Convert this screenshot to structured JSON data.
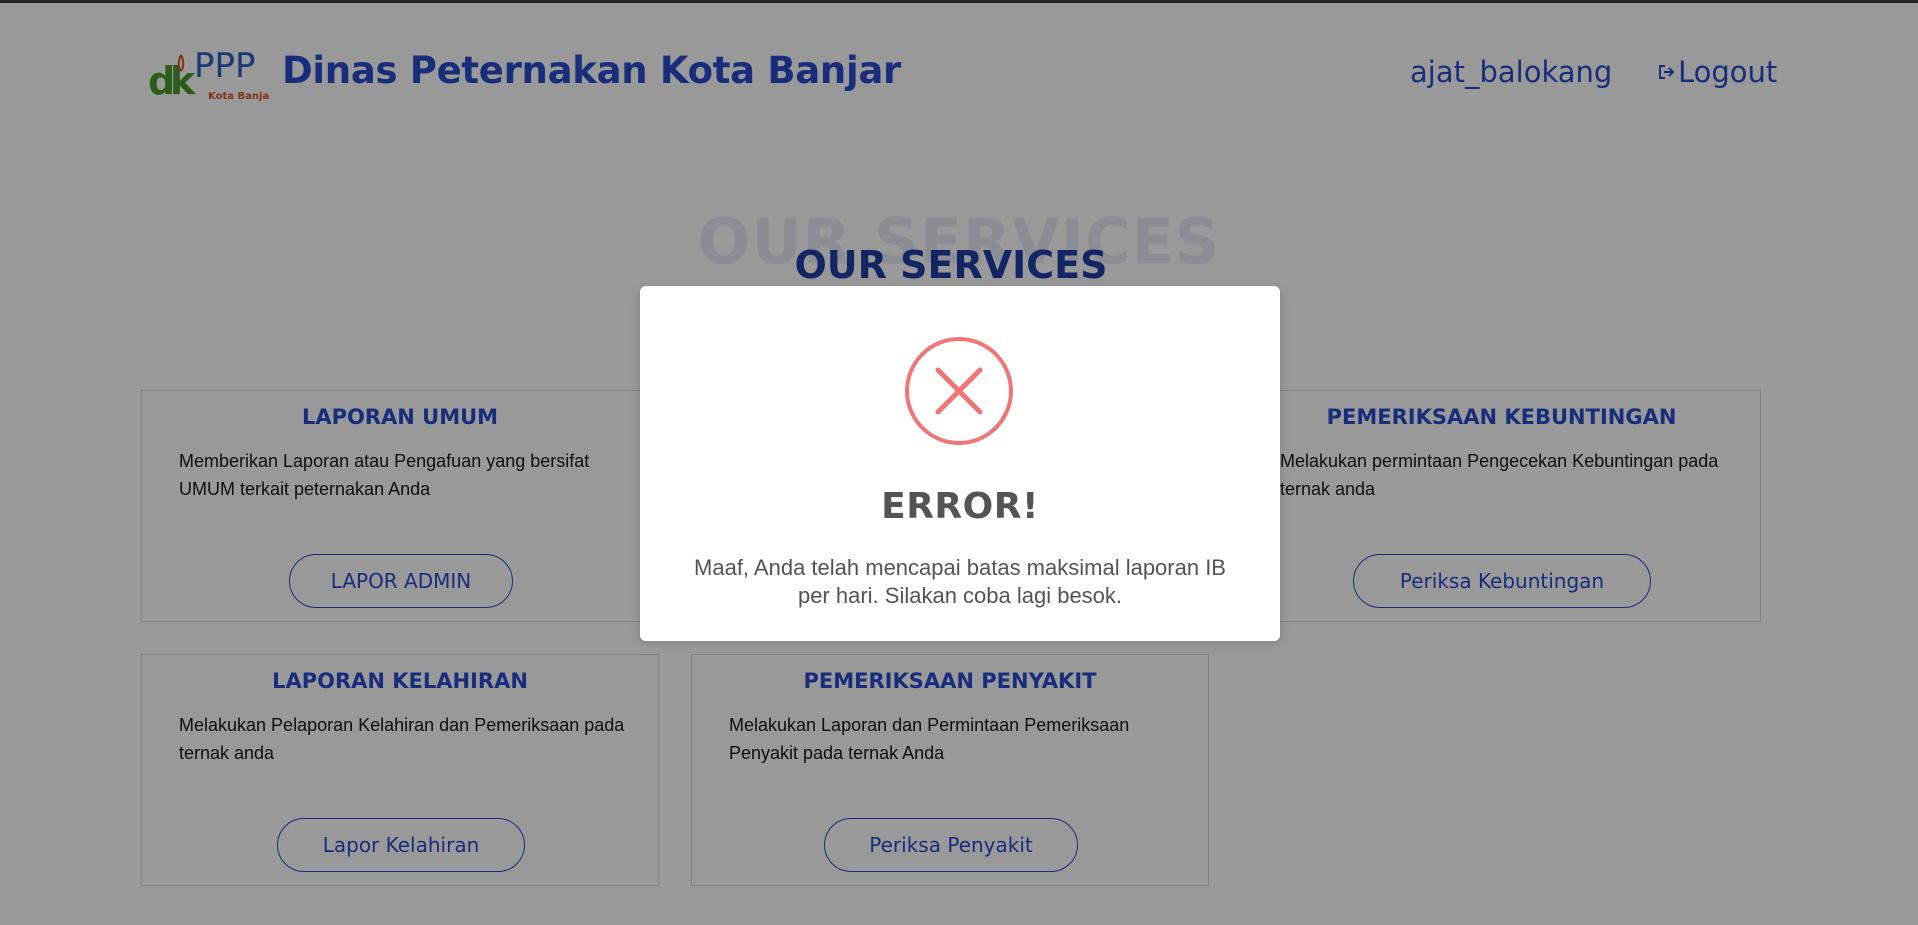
{
  "header": {
    "logo": {
      "main_text": "dkPPP",
      "sub_text": "Kota Banjar"
    },
    "brand_title": "Dinas Peternakan Kota Banjar",
    "username": "ajat_balokang",
    "logout_label": "Logout",
    "logout_icon": "logout-icon"
  },
  "section": {
    "ghost_title": "OUR SERVICES",
    "title": "OUR SERVICES"
  },
  "cards": [
    {
      "title": "LAPORAN UMUM",
      "description": "Memberikan Laporan atau Pengafuan yang bersifat UMUM terkait peternakan Anda",
      "button": "LAPOR ADMIN"
    },
    {
      "title": "PEMERIKSAAN KEBUNTINGAN",
      "description": "Melakukan permintaan Pengecekan Kebuntingan pada ternak anda",
      "button": "Periksa Kebuntingan"
    },
    {
      "title": "LAPORAN KELAHIRAN",
      "description": "Melakukan Pelaporan Kelahiran dan Pemeriksaan pada ternak anda",
      "button": "Lapor Kelahiran"
    },
    {
      "title": "PEMERIKSAAN PENYAKIT",
      "description": "Melakukan Laporan dan Permintaan Pemeriksaan Penyakit pada ternak Anda",
      "button": "Periksa Penyakit"
    }
  ],
  "modal": {
    "icon": "error-x-icon",
    "title": "ERROR!",
    "message": "Maaf, Anda telah mencapai batas maksimal laporan IB per hari. Silakan coba lagi besok."
  },
  "colors": {
    "brand_blue": "#2b4bd1",
    "title_blue": "#223ea8",
    "error_red": "#f27474",
    "overlay": "rgba(0,0,0,0.4)"
  }
}
